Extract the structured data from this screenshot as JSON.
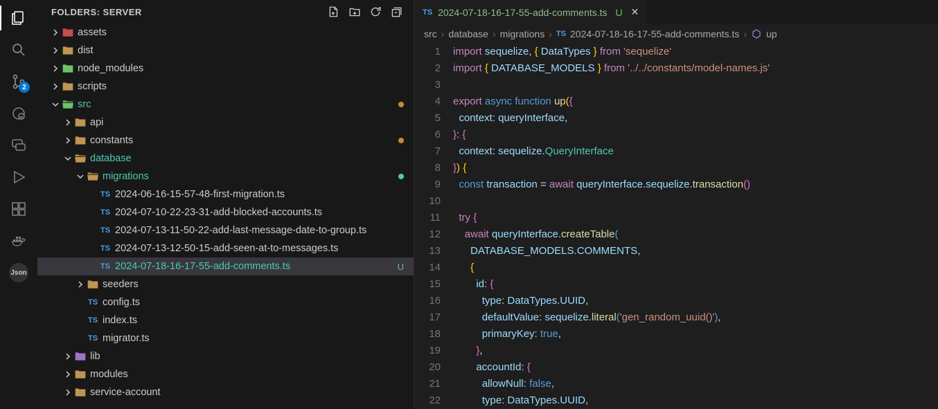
{
  "activity": {
    "scm_badge": "2",
    "json_label": "Json"
  },
  "sidebar": {
    "title": "FOLDERS: SERVER",
    "tree": [
      {
        "depth": 0,
        "kind": "folder",
        "chev": "right",
        "icon": "folder-red",
        "label": "assets"
      },
      {
        "depth": 0,
        "kind": "folder",
        "chev": "right",
        "icon": "folder-yellow",
        "label": "dist"
      },
      {
        "depth": 0,
        "kind": "folder",
        "chev": "right",
        "icon": "folder-green-pkg",
        "label": "node_modules"
      },
      {
        "depth": 0,
        "kind": "folder",
        "chev": "right",
        "icon": "folder-yellow",
        "label": "scripts"
      },
      {
        "depth": 0,
        "kind": "folder",
        "chev": "down",
        "icon": "folder-green-open",
        "label": "src",
        "highlight": true,
        "dot": "orange"
      },
      {
        "depth": 1,
        "kind": "folder",
        "chev": "right",
        "icon": "folder-yellow",
        "label": "api"
      },
      {
        "depth": 1,
        "kind": "folder",
        "chev": "right",
        "icon": "folder-yellow",
        "label": "constants",
        "dot": "orange"
      },
      {
        "depth": 1,
        "kind": "folder",
        "chev": "down",
        "icon": "folder-yellow-open",
        "label": "database",
        "highlight": true
      },
      {
        "depth": 2,
        "kind": "folder",
        "chev": "down",
        "icon": "folder-yellow-open",
        "label": "migrations",
        "highlight": true,
        "dot": "green"
      },
      {
        "depth": 3,
        "kind": "file",
        "icon": "ts",
        "label": "2024-06-16-15-57-48-first-migration.ts"
      },
      {
        "depth": 3,
        "kind": "file",
        "icon": "ts",
        "label": "2024-07-10-22-23-31-add-blocked-accounts.ts"
      },
      {
        "depth": 3,
        "kind": "file",
        "icon": "ts",
        "label": "2024-07-13-11-50-22-add-last-message-date-to-group.ts"
      },
      {
        "depth": 3,
        "kind": "file",
        "icon": "ts",
        "label": "2024-07-13-12-50-15-add-seen-at-to-messages.ts"
      },
      {
        "depth": 3,
        "kind": "file",
        "icon": "ts",
        "label": "2024-07-18-16-17-55-add-comments.ts",
        "selected": true,
        "highlight": true,
        "tag": "U"
      },
      {
        "depth": 2,
        "kind": "folder",
        "chev": "right",
        "icon": "folder-yellow",
        "label": "seeders"
      },
      {
        "depth": 2,
        "kind": "file",
        "icon": "ts",
        "label": "config.ts"
      },
      {
        "depth": 2,
        "kind": "file",
        "icon": "ts",
        "label": "index.ts"
      },
      {
        "depth": 2,
        "kind": "file",
        "icon": "ts",
        "label": "migrator.ts"
      },
      {
        "depth": 1,
        "kind": "folder",
        "chev": "right",
        "icon": "folder-purple",
        "label": "lib"
      },
      {
        "depth": 1,
        "kind": "folder",
        "chev": "right",
        "icon": "folder-yellow",
        "label": "modules"
      },
      {
        "depth": 1,
        "kind": "folder",
        "chev": "right",
        "icon": "folder-yellow",
        "label": "service-account"
      }
    ]
  },
  "tab": {
    "name": "2024-07-18-16-17-55-add-comments.ts",
    "status": "U"
  },
  "breadcrumb": [
    "src",
    "database",
    "migrations",
    "2024-07-18-16-17-55-add-comments.ts",
    "up"
  ],
  "code_lines": 22
}
